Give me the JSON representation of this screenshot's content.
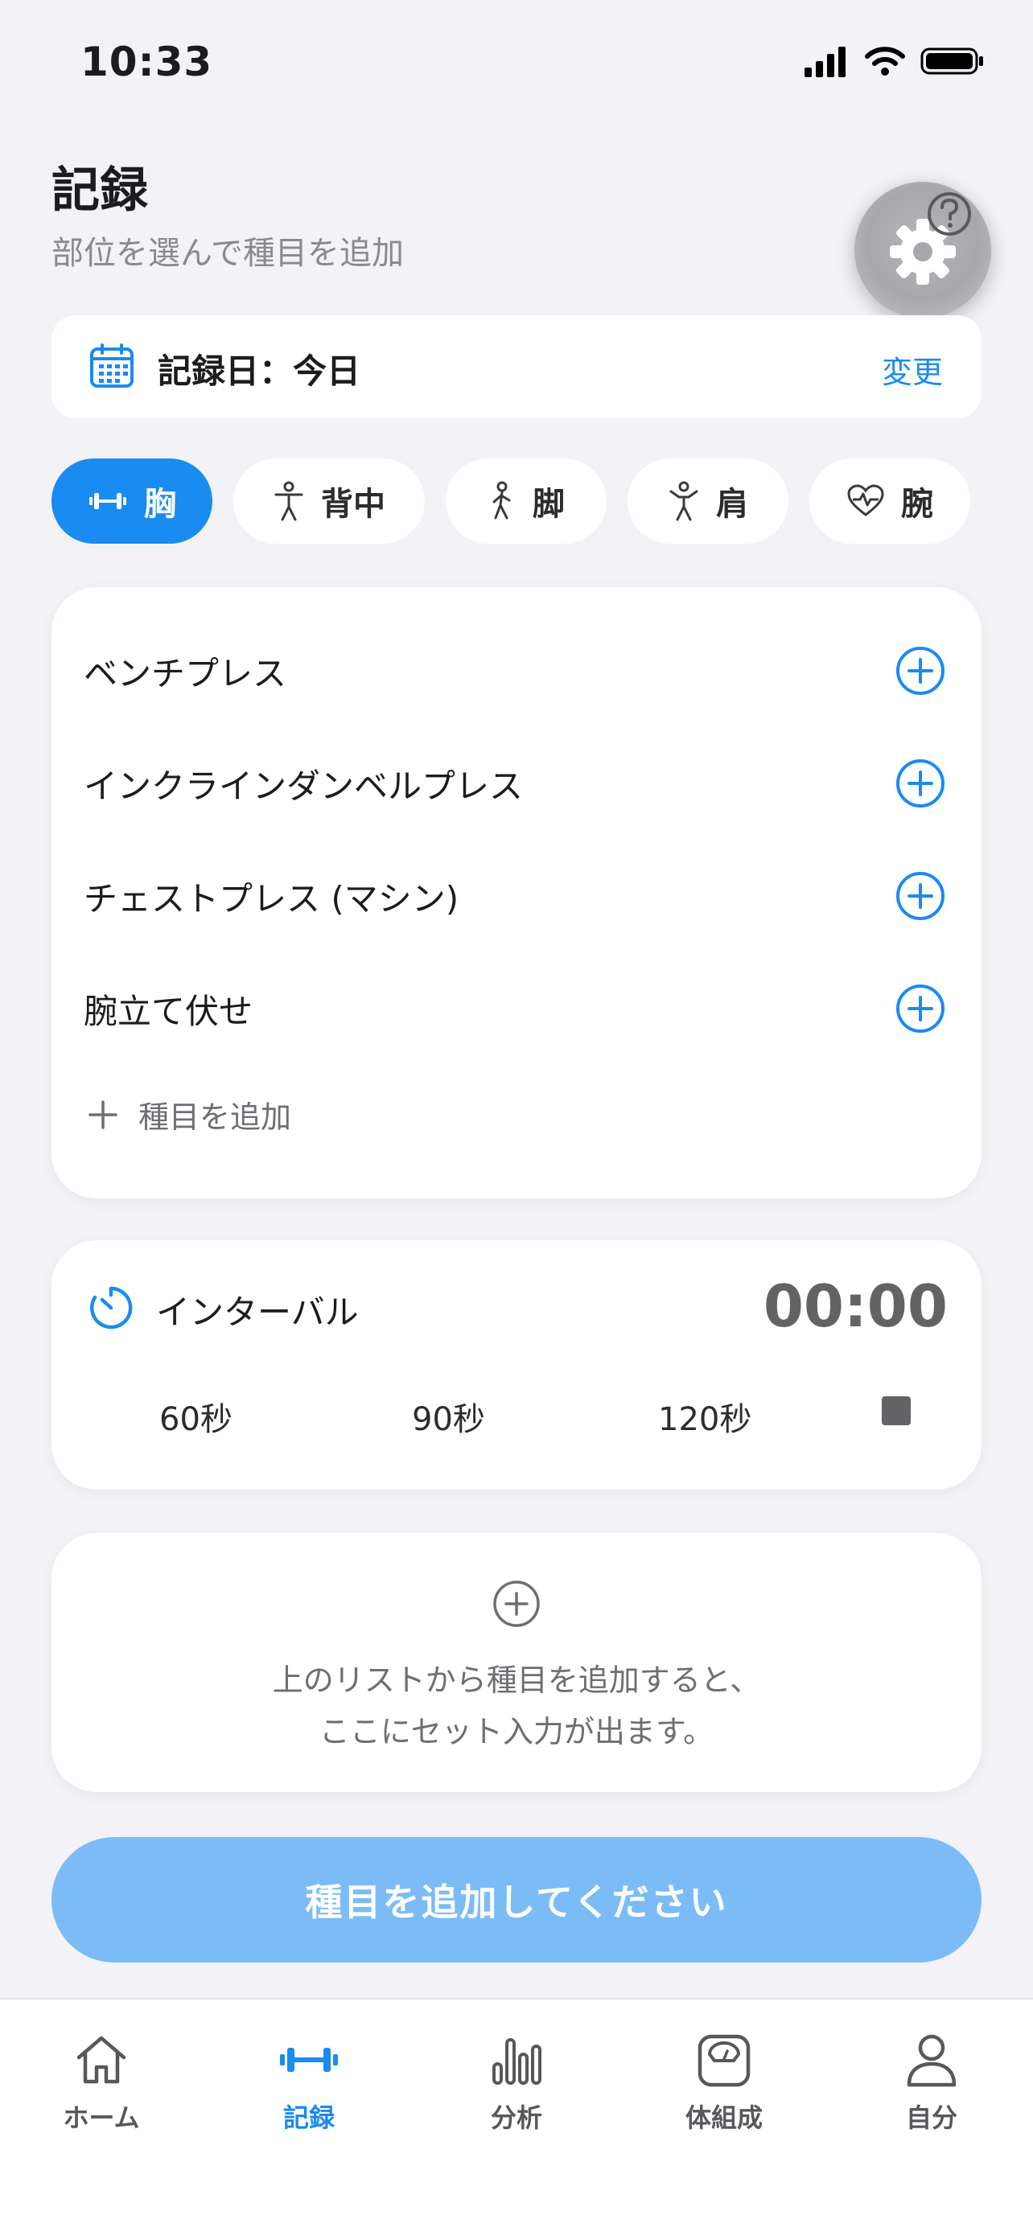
{
  "status_bar": {
    "time": "10:33"
  },
  "header": {
    "title": "記録",
    "subtitle": "部位を選んで種目を追加"
  },
  "date_card": {
    "label": "記録日：今日",
    "change_label": "変更"
  },
  "body_parts": [
    {
      "label": "胸",
      "icon": "dumbbell-icon",
      "active": true
    },
    {
      "label": "背中",
      "icon": "figure-icon",
      "active": false
    },
    {
      "label": "脚",
      "icon": "walk-icon",
      "active": false
    },
    {
      "label": "肩",
      "icon": "figure-arms-icon",
      "active": false
    },
    {
      "label": "腕",
      "icon": "heart-pulse-icon",
      "active": false
    }
  ],
  "exercises": {
    "items": [
      {
        "name": "ベンチプレス"
      },
      {
        "name": "インクラインダンベルプレス"
      },
      {
        "name": "チェストプレス (マシン)"
      },
      {
        "name": "腕立て伏せ"
      }
    ],
    "add_label": "種目を追加"
  },
  "interval": {
    "label": "インターバル",
    "time": "00:00",
    "options": [
      "60秒",
      "90秒",
      "120秒"
    ]
  },
  "empty_state": {
    "line1": "上のリストから種目を追加すると、",
    "line2": "ここにセット入力が出ます。"
  },
  "cta": {
    "label": "種目を追加してください"
  },
  "tabbar": {
    "items": [
      {
        "label": "ホーム",
        "icon": "home-icon",
        "active": false
      },
      {
        "label": "記録",
        "icon": "dumbbell-icon",
        "active": true
      },
      {
        "label": "分析",
        "icon": "bar-chart-icon",
        "active": false
      },
      {
        "label": "体組成",
        "icon": "scale-icon",
        "active": false
      },
      {
        "label": "自分",
        "icon": "person-icon",
        "active": false
      }
    ]
  },
  "colors": {
    "accent": "#1a8bf0",
    "cta_disabled": "#7bbcf6",
    "background": "#f2f2f7"
  }
}
